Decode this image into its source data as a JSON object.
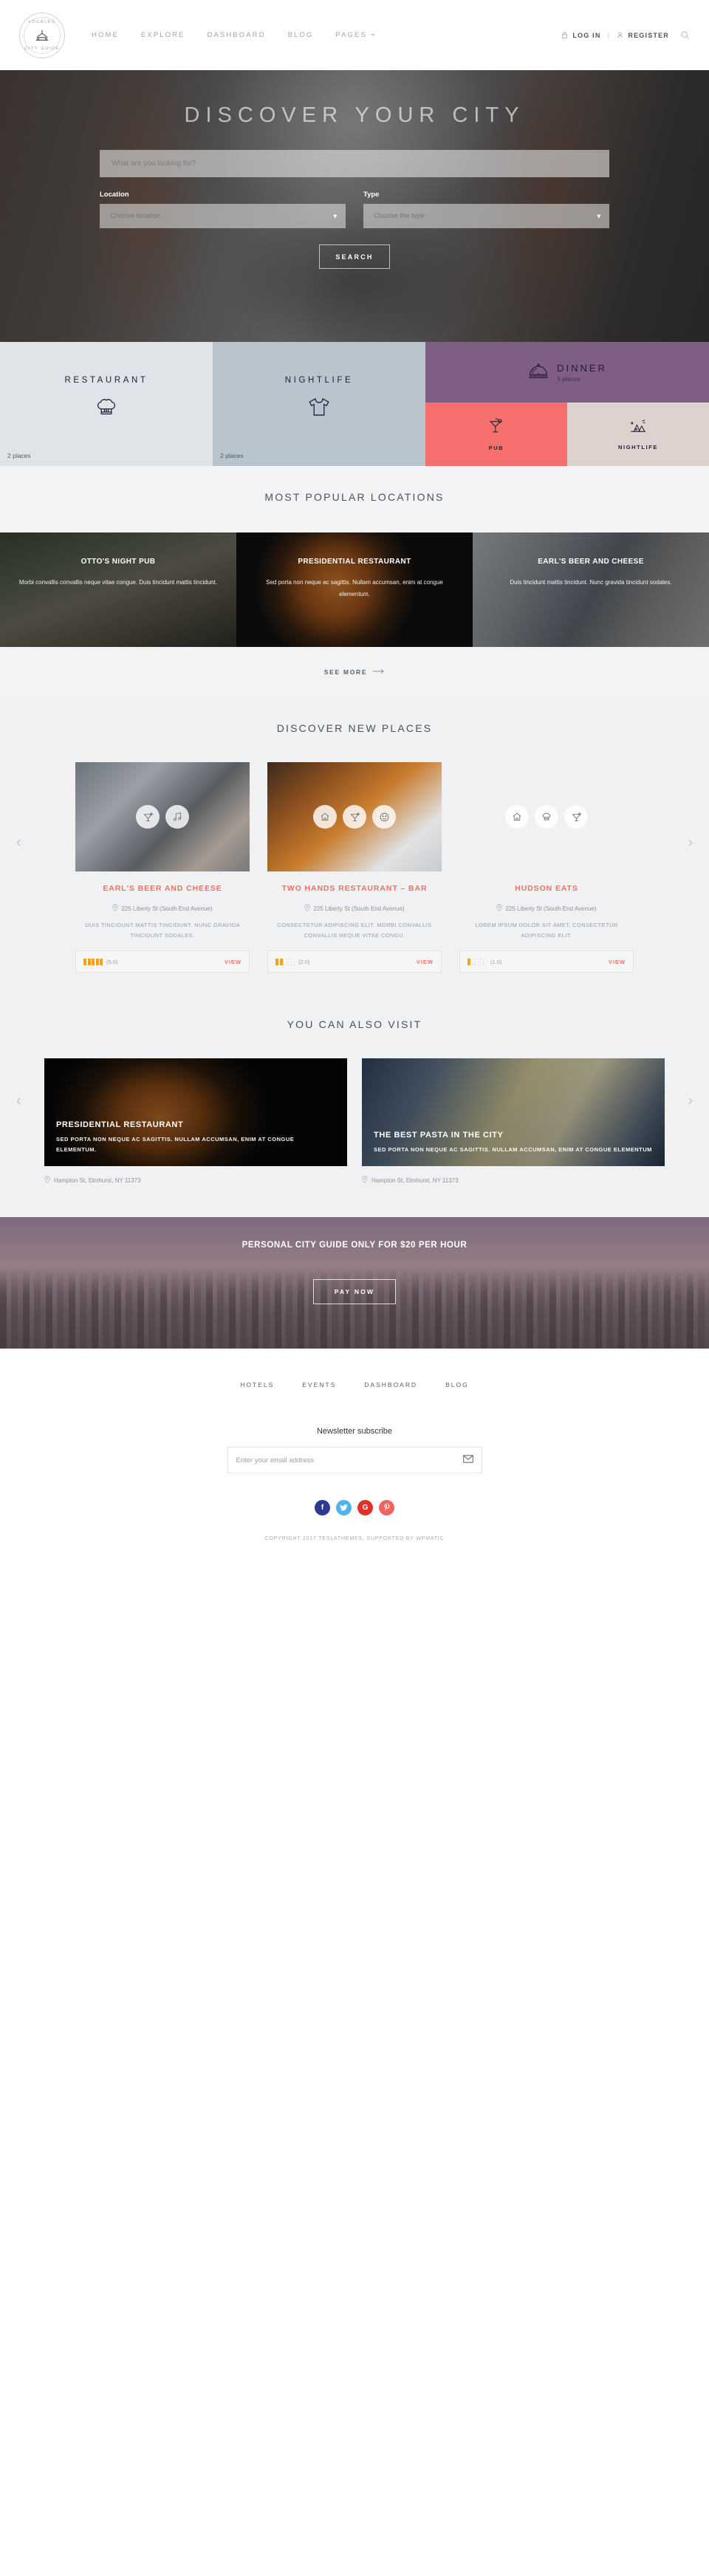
{
  "brand": {
    "name": "LOCALES",
    "sub": "CITY GUIDE"
  },
  "nav": {
    "items": [
      {
        "label": "HOME",
        "caret": false
      },
      {
        "label": "EXPLORE",
        "caret": false
      },
      {
        "label": "DASHBOARD",
        "caret": false
      },
      {
        "label": "BLOG",
        "caret": false
      },
      {
        "label": "PAGES",
        "caret": true
      }
    ],
    "login": "LOG IN",
    "divider": "|",
    "register": "REGISTER",
    "search_icon": "search-icon",
    "lock_icon": "lock-icon",
    "user_icon": "user-icon"
  },
  "hero": {
    "title": "DISCOVER YOUR CITY",
    "search_placeholder": "What are you looking for?",
    "location_label": "Location",
    "location_value": "Choose location",
    "type_label": "Type",
    "type_value": "Choose the type",
    "search_button": "SEARCH"
  },
  "categories": [
    {
      "name": "RESTAURANT",
      "count": "2 places",
      "icon": "chef-hat-icon"
    },
    {
      "name": "NIGHTLIFE",
      "count": "2 places",
      "icon": "tshirt-icon"
    },
    {
      "name": "DINNER",
      "count": "3 places",
      "icon": "cloche-icon"
    },
    {
      "name": "PUB",
      "count": "",
      "icon": "cocktail-icon"
    },
    {
      "name": "NIGHTLIFE",
      "count": "",
      "icon": "fireworks-icon"
    }
  ],
  "popular": {
    "title": "MOST POPULAR LOCATIONS",
    "tiles": [
      {
        "title": "OTTO'S NIGHT PUB",
        "desc": "Morbi convallis convallis neque vitae congue. Duis tincidunt mattis tincidunt."
      },
      {
        "title": "PRESIDENTIAL RESTAURANT",
        "desc": "Sed porta non neque ac sagittis. Nullam accumsan, enim at congue elementum."
      },
      {
        "title": "EARL'S BEER AND CHEESE",
        "desc": "Duis tincidunt mattis tincidunt. Nunc gravida tincidunt sodales."
      }
    ],
    "see_more": "SEE MORE"
  },
  "discover": {
    "title": "DISCOVER NEW PLACES",
    "prev": "‹",
    "next": "›",
    "cards": [
      {
        "title": "EARL'S BEER AND CHEESE",
        "address": "225 Liberty St (South End Avenue)",
        "desc": "DUIS TINCIDUNT MATTIS TINCIDUNT. NUNC GRAVIDA TINCIDUNT SODALES.",
        "rating": "(5.0)",
        "rating_filled": 5,
        "view": "VIEW",
        "badges": [
          "cocktail-icon",
          "music-icon"
        ]
      },
      {
        "title": "TWO HANDS RESTAURANT – BAR",
        "address": "225 Liberty St (South End Avenue)",
        "desc": "CONSECTETUR ADIPISCING ELIT. MORBI CONVALLIS CONVALLIS NEQUE VITAE CONGU.",
        "rating": "(2.0)",
        "rating_filled": 2,
        "view": "VIEW",
        "badges": [
          "home-icon",
          "cocktail-icon",
          "smiley-icon"
        ]
      },
      {
        "title": "HUDSON EATS",
        "address": "225 Liberty St (South End Avenue)",
        "desc": "LOREM IPSUM DOLOR SIT AMET, CONSECTETUR ADIPISCING ELIT.",
        "rating": "(1.0)",
        "rating_filled": 1,
        "view": "VIEW",
        "badges": [
          "home-icon",
          "chef-hat-icon",
          "cocktail-icon"
        ]
      }
    ]
  },
  "also_visit": {
    "title": "YOU CAN ALSO VISIT",
    "prev": "‹",
    "next": "›",
    "cards": [
      {
        "title": "PRESIDENTIAL RESTAURANT",
        "desc": "SED PORTA NON NEQUE AC SAGITTIS. NULLAM ACCUMSAN, ENIM AT CONGUE ELEMENTUM.",
        "address": "Hampton St, Elmhurst, NY 11373"
      },
      {
        "title": "THE BEST PASTA IN THE CITY",
        "desc": "SED PORTA NON NEQUE AC SAGITTIS. NULLAM ACCUMSAN, ENIM AT CONGUE ELEMENTUM",
        "address": "Hampton St, Elmhurst, NY 11373"
      }
    ]
  },
  "cta": {
    "title": "PERSONAL CITY GUIDE ONLY FOR $20 PER HOUR",
    "button": "PAY NOW"
  },
  "footer": {
    "nav": [
      "HOTELS",
      "EVENTS",
      "DASHBOARD",
      "BLOG"
    ],
    "newsletter_title": "Newsletter subscribe",
    "newsletter_placeholder": "Enter your email address",
    "envelope_icon": "envelope-icon",
    "socials": [
      {
        "name": "facebook",
        "glyph": "f",
        "color": "#2b3990"
      },
      {
        "name": "twitter",
        "glyph": "ᵛ",
        "color": "#4fb3f0"
      },
      {
        "name": "google-plus",
        "glyph": "G",
        "color": "#e03127"
      },
      {
        "name": "pinterest",
        "glyph": "ⓟ",
        "color": "#f4635f"
      }
    ],
    "copyright": "COPYRIGHT 2017 TESLATHEMES, SUPPORTED BY WPMATIC"
  },
  "colors": {
    "accent": "#f36f63",
    "rating": "#f9a11b",
    "dinner": "#7f5e83",
    "pub": "#f7706e",
    "nightlife": "#ddd2cd",
    "restaurant_tile": "#e0e3e7",
    "nightlife_tile": "#b9c5ce"
  }
}
